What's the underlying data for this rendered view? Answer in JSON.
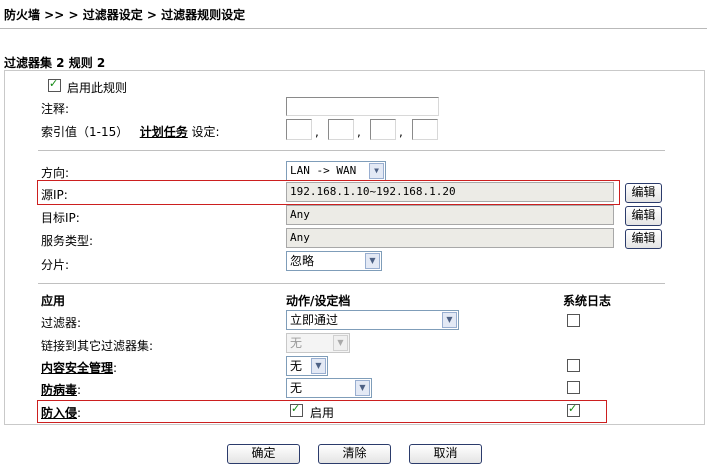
{
  "breadcrumb": "防火墙 >> > 过滤器设定 > 过滤器规则设定",
  "set_title": "过滤器集 2 规则 2",
  "enable_rule": {
    "label": "启用此规则",
    "checked": true
  },
  "comment": {
    "label": "注释:",
    "value": ""
  },
  "index": {
    "label_prefix": "索引值（1-15）",
    "link": "计划任务",
    "label_suffix": "设定:",
    "values": [
      "",
      "",
      "",
      ""
    ],
    "sep": ","
  },
  "direction": {
    "label": "方向:",
    "value": "LAN -> WAN"
  },
  "source_ip": {
    "label": "源IP:",
    "value": "192.168.1.10~192.168.1.20",
    "edit": "编辑"
  },
  "dest_ip": {
    "label": "目标IP:",
    "value": "Any",
    "edit": "编辑"
  },
  "service": {
    "label": "服务类型:",
    "value": "Any",
    "edit": "编辑"
  },
  "fragment": {
    "label": "分片:",
    "value": "忽略"
  },
  "headers": {
    "app": "应用",
    "action": "动作/设定档",
    "log": "系统日志"
  },
  "rows": {
    "filter": {
      "label": "过滤器:",
      "value": "立即通过",
      "log": false
    },
    "link_other": {
      "label": "链接到其它过滤器集:",
      "value": "无"
    },
    "csm": {
      "label": "内容安全管理",
      "colon": ":",
      "value": "无",
      "log": false
    },
    "antivirus": {
      "label": "防病毒",
      "colon": ":",
      "value": "无",
      "log": false
    },
    "ips": {
      "label": "防入侵",
      "colon": ":",
      "enable_label": "启用",
      "enabled": true,
      "log": true
    }
  },
  "buttons": {
    "ok": "确定",
    "clear": "清除",
    "cancel": "取消"
  }
}
